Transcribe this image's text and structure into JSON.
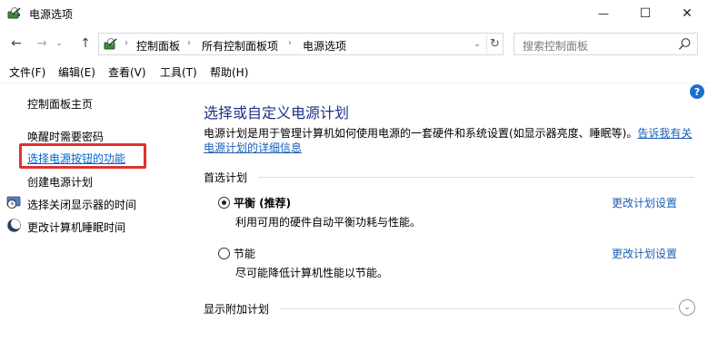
{
  "window": {
    "title": "电源选项",
    "icon": "power-options-icon",
    "minimize_glyph": "—",
    "maximize_glyph": "☐",
    "close_glyph": "✕"
  },
  "nav": {
    "back_glyph": "←",
    "forward_glyph": "→",
    "recent_glyph": "⌄",
    "up_glyph": "↑"
  },
  "address": {
    "crumbs": [
      "控制面板",
      "所有控制面板项",
      "电源选项"
    ],
    "separator": "›",
    "dropdown_glyph": "⌄",
    "refresh_glyph": "↻"
  },
  "search": {
    "placeholder": "搜索控制面板"
  },
  "menu": [
    "文件(F)",
    "编辑(E)",
    "查看(V)",
    "工具(T)",
    "帮助(H)"
  ],
  "sidebar": {
    "home": "控制面板主页",
    "items": [
      {
        "label": "唤醒时需要密码",
        "icon": null
      },
      {
        "label": "选择电源按钮的功能",
        "icon": null,
        "highlighted": true
      },
      {
        "label": "创建电源计划",
        "icon": null
      },
      {
        "label": "选择关闭显示器的时间",
        "icon": "monitor-clock-icon"
      },
      {
        "label": "更改计算机睡眠时间",
        "icon": "moon-icon"
      }
    ]
  },
  "help_glyph": "?",
  "main": {
    "title": "选择或自定义电源计划",
    "description": "电源计划是用于管理计算机如何使用电源的一套硬件和系统设置(如显示器亮度、睡眠等)。",
    "description_link_1": "告诉我有关",
    "description_link_2": "电源计划的详细信息",
    "preferred_group": "首选计划",
    "plans": [
      {
        "name": "平衡 (推荐)",
        "desc": "利用可用的硬件自动平衡功耗与性能。",
        "selected": true,
        "link": "更改计划设置"
      },
      {
        "name": "节能",
        "desc": "尽可能降低计算机性能以节能。",
        "selected": false,
        "link": "更改计划设置"
      }
    ],
    "additional_group": "显示附加计划",
    "expand_glyph": "⌄"
  },
  "colors": {
    "title_blue": "#1e3287",
    "link_blue": "#1a5fb4",
    "highlight_red": "#e03030"
  }
}
